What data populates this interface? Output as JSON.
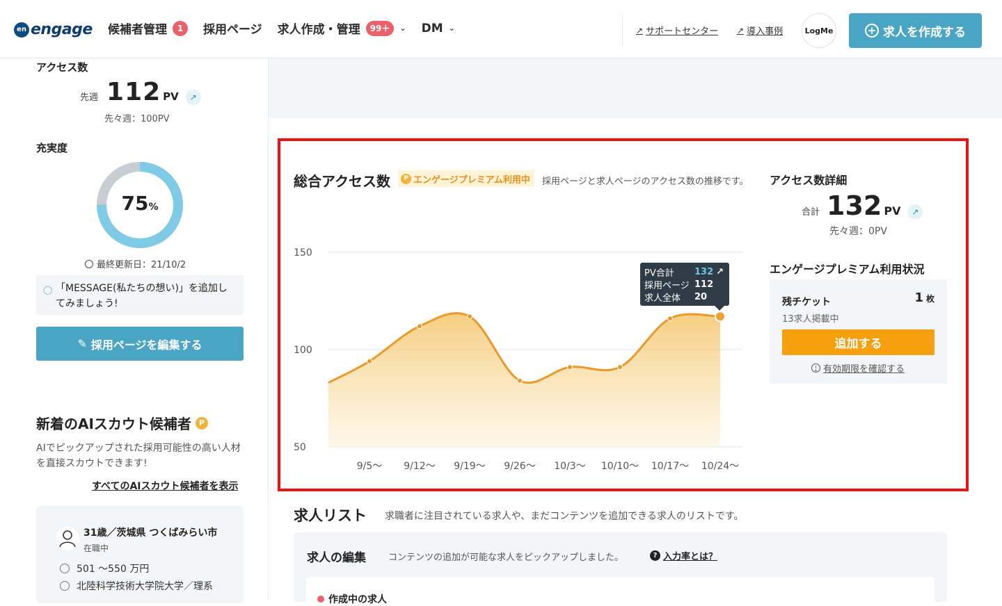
{
  "header": {
    "logo_mark": "en",
    "logo_text": "engage",
    "nav": [
      {
        "label": "候補者管理",
        "badge": "1"
      },
      {
        "label": "採用ページ",
        "badge": ""
      },
      {
        "label": "求人作成・管理",
        "badge": "99＋"
      },
      {
        "label": "DM",
        "badge": ""
      }
    ],
    "support_link": "サポートセンター",
    "cases_link": "導入事例",
    "logme": "LogMe",
    "create_button": "求人を作成する"
  },
  "sidebar": {
    "access_title": "アクセス数",
    "last_week_label": "先週",
    "last_week_pv": "112",
    "pv_unit": "PV",
    "prev_week": "先々週：100PV",
    "fulfillment_title": "充実度",
    "fulfillment_value": "75",
    "fulfillment_percent": 0.75,
    "percent_sign": "%",
    "updated": "最終更新日：21/10/2",
    "tip": "「MESSAGE(私たちの想い)」を追加してみましょう!",
    "edit_button": "採用ページを編集する",
    "ai_title": "新着のAIスカウト候補者",
    "ai_desc": "AIでピックアップされた採用可能性の高い人材を直接スカウトできます!",
    "ai_link": "すべてのAIスカウト候補者を表示",
    "candidate": {
      "name": "31歳／茨城県 つくばみらい市",
      "status": "在職中",
      "salary": "501 ～550 万円",
      "school": "北陸科学技術大学院大学／理系"
    }
  },
  "chart_panel": {
    "title": "総合アクセス数",
    "premium_tag": "エンゲージプレミアム利用中",
    "subtitle": "採用ページと求人ページのアクセス数の推移です。",
    "tooltip": {
      "rows": [
        {
          "label": "PV合計",
          "value": "132"
        },
        {
          "label": "採用ページ",
          "value": "112"
        },
        {
          "label": "求人全体",
          "value": "20"
        }
      ]
    }
  },
  "chart_data": {
    "type": "area",
    "x": [
      "9/5～",
      "9/12～",
      "9/19～",
      "9/26～",
      "10/3～",
      "10/10～",
      "10/17～",
      "10/24～"
    ],
    "values": [
      94,
      112,
      117,
      84,
      91,
      91,
      116,
      117
    ],
    "start_value": 83,
    "yticks": [
      150,
      100,
      50
    ],
    "ylim": [
      50,
      150
    ],
    "color": "#f0a030",
    "title": "",
    "xlabel": "",
    "ylabel": ""
  },
  "detail": {
    "title": "アクセス数詳細",
    "total_label": "合計",
    "total_pv": "132",
    "pv_unit": "PV",
    "prev": "先々週：0PV",
    "premium_title": "エンゲージプレミアム利用状況",
    "ticket_label": "残チケット",
    "ticket_count": "1",
    "ticket_unit": "枚",
    "ticket_sub": "13求人掲載中",
    "add_button": "追加する",
    "expiry_link": "有効期限を確認する"
  },
  "joblist": {
    "title": "求人リスト",
    "subtitle": "求職者に注目されている求人や、まだコンテンツを追加できる求人のリストです。",
    "edit_title": "求人の編集",
    "edit_sub": "コンテンツの追加が可能な求人をピックアップしました。",
    "rate_link": "入力率とは？",
    "creating_label": "作成中の求人"
  },
  "colors": {
    "accent": "#4aa5c4",
    "badge": "#e8616b",
    "orange": "#f6a010",
    "highlight_box": "#ee1111"
  }
}
